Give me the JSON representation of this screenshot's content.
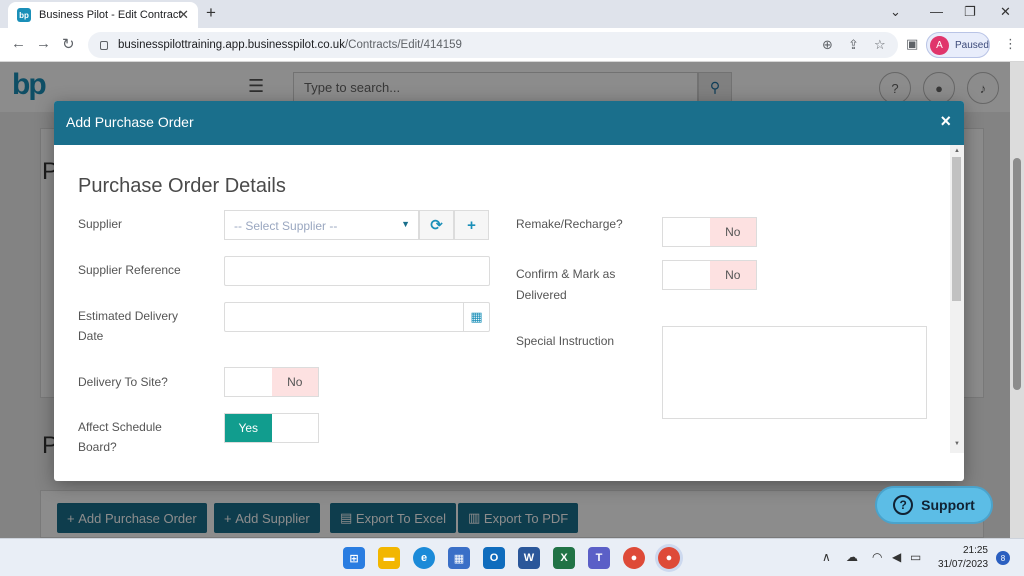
{
  "browser": {
    "tab_title": "Business Pilot - Edit Contract",
    "tab_favicon_text": "bp",
    "new_tab": "+",
    "url_host": "businesspilottraining.app.businesspilot.co.uk",
    "url_path": "/Contracts/Edit/414159",
    "profile_initial": "A",
    "profile_status": "Paused"
  },
  "app": {
    "logo_text": "bp",
    "search_placeholder": "Type to search...",
    "bottom_buttons": [
      {
        "icon": "plus-icon",
        "label": "Add Purchase Order"
      },
      {
        "icon": "plus-icon",
        "label": "Add Supplier"
      },
      {
        "icon": "excel-icon",
        "label": "Export To Excel"
      },
      {
        "icon": "pdf-icon",
        "label": "Export To PDF"
      }
    ],
    "support_label": "Support"
  },
  "modal": {
    "title": "Add Purchase Order",
    "close": "×",
    "section_title": "Purchase Order Details",
    "supplier": {
      "label": "Supplier",
      "placeholder": "-- Select Supplier --"
    },
    "supplier_reference": {
      "label": "Supplier Reference",
      "value": ""
    },
    "estimated_delivery_date": {
      "label_line1": "Estimated Delivery",
      "label_line2": "Date",
      "value": ""
    },
    "delivery_to_site": {
      "label": "Delivery To Site?",
      "value": "No"
    },
    "affect_schedule_board": {
      "label_line1": "Affect Schedule",
      "label_line2": "Board?",
      "value": "Yes"
    },
    "remake_recharge": {
      "label": "Remake/Recharge?",
      "value": "No"
    },
    "confirm_mark_delivered": {
      "label_line1": "Confirm & Mark as",
      "label_line2": "Delivered",
      "value": "No"
    },
    "special_instruction": {
      "label": "Special Instruction",
      "value": ""
    }
  },
  "taskbar": {
    "time": "21:25",
    "date": "31/07/2023",
    "notifications": "8"
  },
  "colors": {
    "header_teal": "#1a6f8c",
    "toggle_yes": "#119d8e",
    "toggle_no": "#fde1e1"
  }
}
